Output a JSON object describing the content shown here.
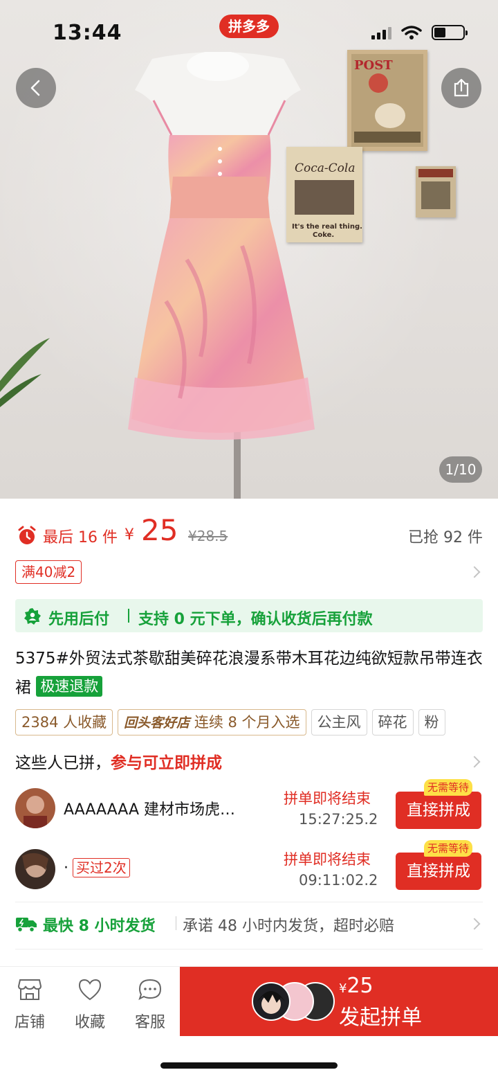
{
  "status_bar": {
    "time": "13:44",
    "app_badge": "拼多多"
  },
  "gallery": {
    "counter": "1/10"
  },
  "price_block": {
    "limit_text": "最后 16 件",
    "currency": "¥",
    "price": "25",
    "original_price": "¥28.5",
    "sold_text": "已抢 92 件"
  },
  "coupon": {
    "label": "满40减2"
  },
  "pay_later": {
    "title": "先用后付",
    "desc": "支持 0 元下单，确认收货后再付款"
  },
  "product": {
    "title": "5375#外贸法式茶歇甜美碎花浪漫系带木耳花边纯欲短款吊带连衣裙",
    "badge": "极速退款"
  },
  "tags": {
    "favorites": "2384 人收藏",
    "store_badge": "回头客好店",
    "store_text": "连续 8 个月入选",
    "tag1": "公主风",
    "tag2": "碎花",
    "tag3": "粉"
  },
  "group": {
    "heading": "这些人已拼，",
    "heading_highlight": "参与可立即拼成",
    "rows": [
      {
        "name": "AAAAAAA 建材市场虎…",
        "bought": "",
        "ending": "拼单即将结束",
        "countdown": "15:27:25.2",
        "button": "直接拼成",
        "no_wait": "无需等待"
      },
      {
        "name": "·",
        "bought": "买过2次",
        "ending": "拼单即将结束",
        "countdown": "09:11:02.2",
        "button": "直接拼成",
        "no_wait": "无需等待"
      }
    ]
  },
  "shipping": {
    "title": "最快 8 小时发货",
    "desc": "承诺 48 小时内发货，超时必赔"
  },
  "bottom_bar": {
    "store": "店铺",
    "favorite": "收藏",
    "service": "客服",
    "cta_currency": "¥",
    "cta_price": "25",
    "cta_label": "发起拼单"
  },
  "colors": {
    "brand_red": "#e02e24",
    "green": "#16a13a"
  },
  "icons": [
    "back-icon",
    "share-icon",
    "clock-icon",
    "pay-later-icon",
    "truck-icon",
    "store-icon",
    "heart-icon",
    "chat-icon",
    "chevron-right-icon"
  ]
}
